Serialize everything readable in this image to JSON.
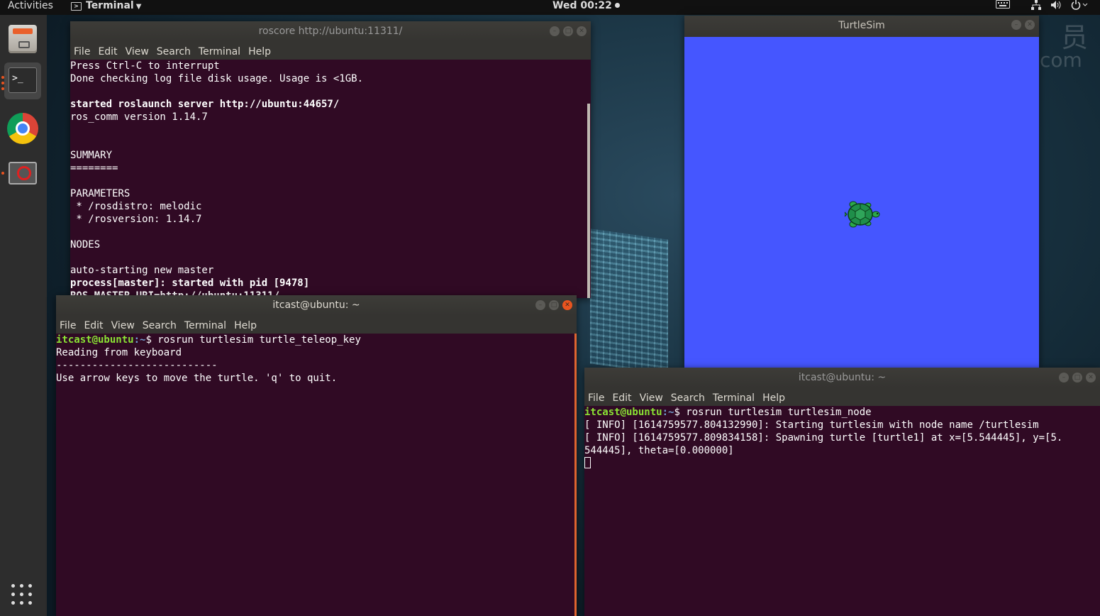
{
  "topbar": {
    "activities": "Activities",
    "app_menu": "Terminal",
    "clock": "Wed 00:22"
  },
  "dock": {
    "items": [
      {
        "name": "files-icon",
        "active": false
      },
      {
        "name": "terminal-icon",
        "active": true
      },
      {
        "name": "chrome-icon",
        "active": false
      },
      {
        "name": "blocked-app-icon",
        "active": false
      }
    ],
    "terminal_glyph": ">_"
  },
  "menu_labels": [
    "File",
    "Edit",
    "View",
    "Search",
    "Terminal",
    "Help"
  ],
  "roscore_window": {
    "title": "roscore http://ubuntu:11311/",
    "lines": [
      {
        "text": "Press Ctrl-C to interrupt",
        "bold": false
      },
      {
        "text": "Done checking log file disk usage. Usage is <1GB.",
        "bold": false
      },
      {
        "text": "",
        "bold": false
      },
      {
        "text": "started roslaunch server http://ubuntu:44657/",
        "bold": true
      },
      {
        "text": "ros_comm version 1.14.7",
        "bold": false
      },
      {
        "text": "",
        "bold": false
      },
      {
        "text": "",
        "bold": false
      },
      {
        "text": "SUMMARY",
        "bold": false
      },
      {
        "text": "========",
        "bold": false
      },
      {
        "text": "",
        "bold": false
      },
      {
        "text": "PARAMETERS",
        "bold": false
      },
      {
        "text": " * /rosdistro: melodic",
        "bold": false
      },
      {
        "text": " * /rosversion: 1.14.7",
        "bold": false
      },
      {
        "text": "",
        "bold": false
      },
      {
        "text": "NODES",
        "bold": false
      },
      {
        "text": "",
        "bold": false
      },
      {
        "text": "auto-starting new master",
        "bold": false
      },
      {
        "text": "process[master]: started with pid [9478]",
        "bold": true
      },
      {
        "text": "ROS_MASTER_URI=http://ubuntu:11311/",
        "bold": true
      }
    ]
  },
  "teleop_window": {
    "title": "itcast@ubuntu: ~",
    "prompt_user": "itcast@ubuntu",
    "prompt_path": ":~",
    "command": "$ rosrun turtlesim turtle_teleop_key",
    "lines": [
      "Reading from keyboard",
      "---------------------------",
      "Use arrow keys to move the turtle. 'q' to quit."
    ]
  },
  "turtlesim_window": {
    "title": "TurtleSim",
    "background_color": "#4556ff"
  },
  "node_window": {
    "title": "itcast@ubuntu: ~",
    "prompt_user": "itcast@ubuntu",
    "prompt_path": ":~",
    "command": "$ rosrun turtlesim turtlesim_node",
    "lines": [
      "[ INFO] [1614759577.804132990]: Starting turtlesim with node name /turtlesim",
      "[ INFO] [1614759577.809834158]: Spawning turtle [turtle1] at x=[5.544445], y=[5.",
      "544445], theta=[0.000000]"
    ]
  },
  "watermark": {
    "w1": "员",
    "w2": "com"
  }
}
